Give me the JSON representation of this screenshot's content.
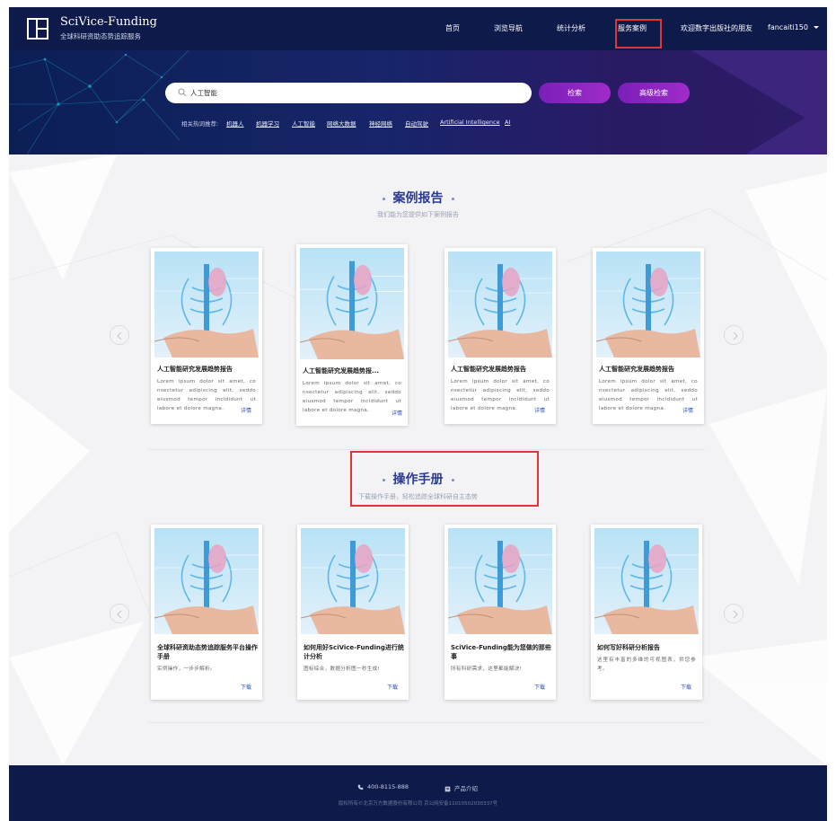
{
  "header": {
    "brand_title": "SciVice-Funding",
    "brand_subtitle": "全球科研资助态势追踪服务",
    "nav": [
      {
        "label": "首页"
      },
      {
        "label": "浏览导航"
      },
      {
        "label": "统计分析"
      },
      {
        "label": "服务案例"
      },
      {
        "label": "欢迎数字出版社的朋友"
      }
    ],
    "user": "fancaiti150"
  },
  "search": {
    "value": "人工智能",
    "search_button": "检索",
    "advanced_button": "高级检索",
    "hot_label": "相关热词推荐:",
    "hot_words": [
      "机器人",
      "机器学习",
      "人工智能",
      "网络大数据",
      "神经网络",
      "自动驾驶",
      "Artificial Intelligence",
      "AI"
    ]
  },
  "cases": {
    "title": "案例报告",
    "subtitle": "我们能为您提供如下案例报告",
    "cards": [
      {
        "title": "人工智能研究发展趋势报告",
        "desc": "Lorem ipsum dolor sit amet, co nsectetur adipiscing elit, seddo eiusmod tempor incididunt ut labore et dolore magna.",
        "link": "详情"
      },
      {
        "title": "人工智能研究发展趋势报...",
        "desc": "Lorem ipsum dolor sit amet, co nsectetur adipiscing elit, seddo eiusmod tempor incididunt ut labore et dolore magna.",
        "link": "详情"
      },
      {
        "title": "人工智能研究发展趋势报告",
        "desc": "Lorem ipsum dolor sit amet, co nsectetur adipiscing elit, seddo eiusmod tempor incididunt ut labore et dolore magna.",
        "link": "详情"
      },
      {
        "title": "人工智能研究发展趋势报告",
        "desc": "Lorem ipsum dolor sit amet, co nsectetur adipiscing elit, seddo eiusmod tempor incididunt ut labore et dolore magna.",
        "link": "详情"
      }
    ]
  },
  "manuals": {
    "title": "操作手册",
    "subtitle": "下载操作手册，轻松追踪全球科研自主态势",
    "cards": [
      {
        "title": "全球科研资助态势追踪服务平台操作手册",
        "desc": "实例操作，一步步解析。",
        "link": "下载"
      },
      {
        "title": "如何用好SciVice-Funding进行统计分析",
        "desc": "图标综合，数据分析图一秒生成!",
        "link": "下载"
      },
      {
        "title": "SciVice-Funding能为您做的那些事",
        "desc": "所有科研需求，这里都能解决!",
        "link": "下载"
      },
      {
        "title": "如何写好科研分析报告",
        "desc": "这里有丰富的多维的可视图表，供您参考。",
        "link": "下载"
      }
    ]
  },
  "footer": {
    "phone": "400-8115-888",
    "intro": "产品介绍",
    "copyright": "版权所有©北京万方数据股份有限公司  京公网安备11010502030337号"
  },
  "colors": {
    "header_bg": "#0d1a4a",
    "accent_purple": "#a02bc9",
    "title_blue": "#2b3a8f",
    "highlight_red": "#e0343a"
  }
}
